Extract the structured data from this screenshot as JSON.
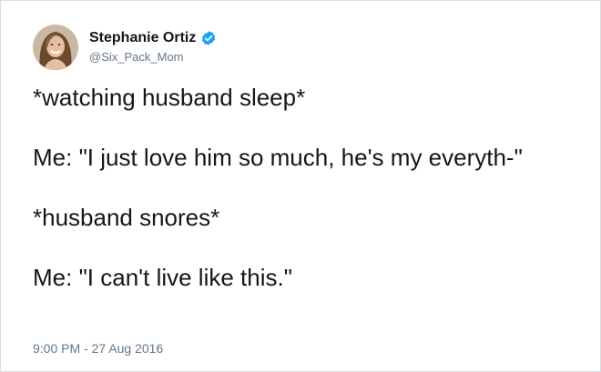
{
  "user": {
    "display_name": "Stephanie Ortiz",
    "handle": "@Six_Pack_Mom",
    "verified": true,
    "avatar_icon": "profile-photo",
    "verified_icon": "verified-badge-icon",
    "accent_color": "#1da1f2"
  },
  "tweet": {
    "line1": "*watching husband sleep*",
    "line2": "Me: \"I just love him so much, he's my everyth-\"",
    "line3": "*husband snores*",
    "line4": "Me: \"I can't live like this.\"",
    "timestamp": "9:00 PM - 27 Aug 2016"
  }
}
